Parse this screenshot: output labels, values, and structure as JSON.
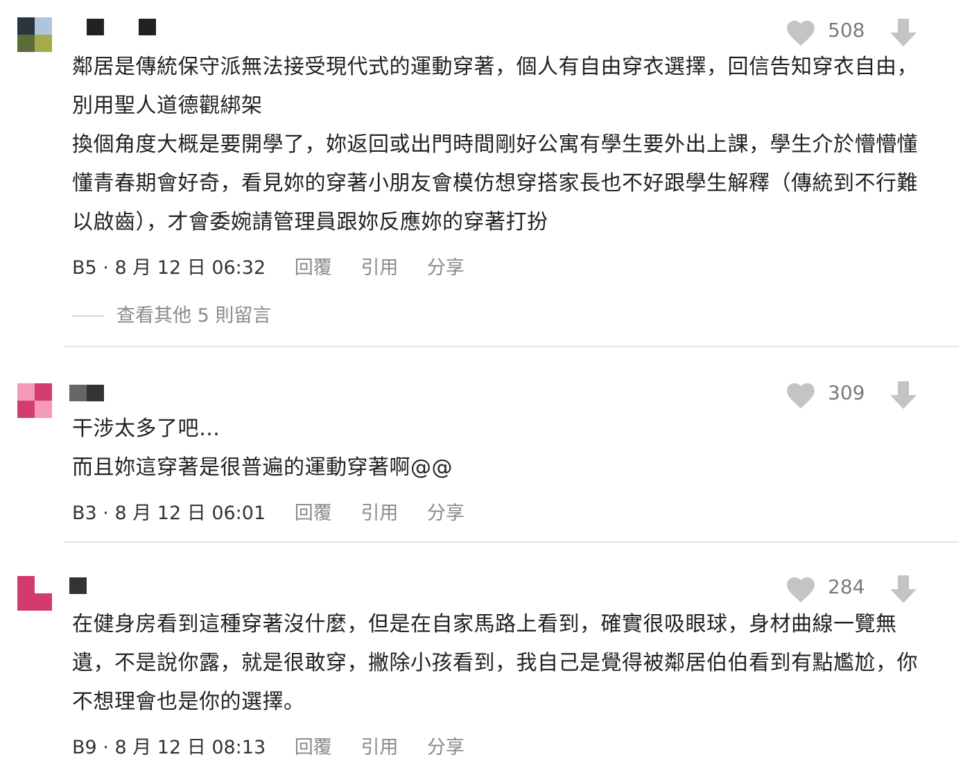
{
  "comments": [
    {
      "id_label": "B5",
      "timestamp": "8 月 12 日 06:32",
      "likes": "508",
      "avatar_colors": [
        "#2a3440",
        "#aec5dd",
        "#5b6b3a",
        "#a6ab4a"
      ],
      "author_blocks": [
        "#222222",
        "#222222"
      ],
      "lines": [
        "鄰居是傳統保守派無法接受現代式的運動穿著，個人有自由穿衣選擇，回信告知穿衣自由，",
        "別用聖人道德觀綁架",
        "換個角度大概是要開學了，妳返回或出門時間剛好公寓有學生要外出上課，學生介於懵懵懂",
        "懂青春期會好奇，看見妳的穿著小朋友會模仿想穿搭家長也不好跟學生解釋（傳統到不行難",
        "以啟齒），才會委婉請管理員跟妳反應妳的穿著打扮"
      ],
      "actions": [
        "回覆",
        "引用",
        "分享"
      ],
      "more_replies": "查看其他 5 則留言"
    },
    {
      "id_label": "B3",
      "timestamp": "8 月 12 日 06:01",
      "likes": "309",
      "avatar_colors": [
        "#f39ab8",
        "#d43d70",
        "#d43d70",
        "#f39ab8"
      ],
      "author_blocks": [
        "#666666",
        "#333333"
      ],
      "lines": [
        "干涉太多了吧…",
        "而且妳這穿著是很普遍的運動穿著啊@@"
      ],
      "actions": [
        "回覆",
        "引用",
        "分享"
      ]
    },
    {
      "id_label": "B9",
      "timestamp": "8 月 12 日 08:13",
      "likes": "284",
      "avatar_colors": [
        "#d23b6e",
        "#ffffff",
        "#d23b6e",
        "#d23b6e"
      ],
      "author_blocks": [
        "#333333"
      ],
      "lines": [
        "在健身房看到這種穿著沒什麼，但是在自家馬路上看到，確實很吸眼球，身材曲線一覽無",
        "遺，不是說你露，就是很敢穿，撇除小孩看到，我自己是覺得被鄰居伯伯看到有點尷尬，你",
        "不想理會也是你的選擇。"
      ],
      "actions": [
        "回覆",
        "引用",
        "分享"
      ]
    }
  ],
  "icons": {
    "like": "heart-icon",
    "downvote": "arrow-down-icon"
  },
  "colors": {
    "icon_gray": "#c4c4c4",
    "muted_text": "#8a8a8a",
    "divider": "#e4e4e4"
  }
}
